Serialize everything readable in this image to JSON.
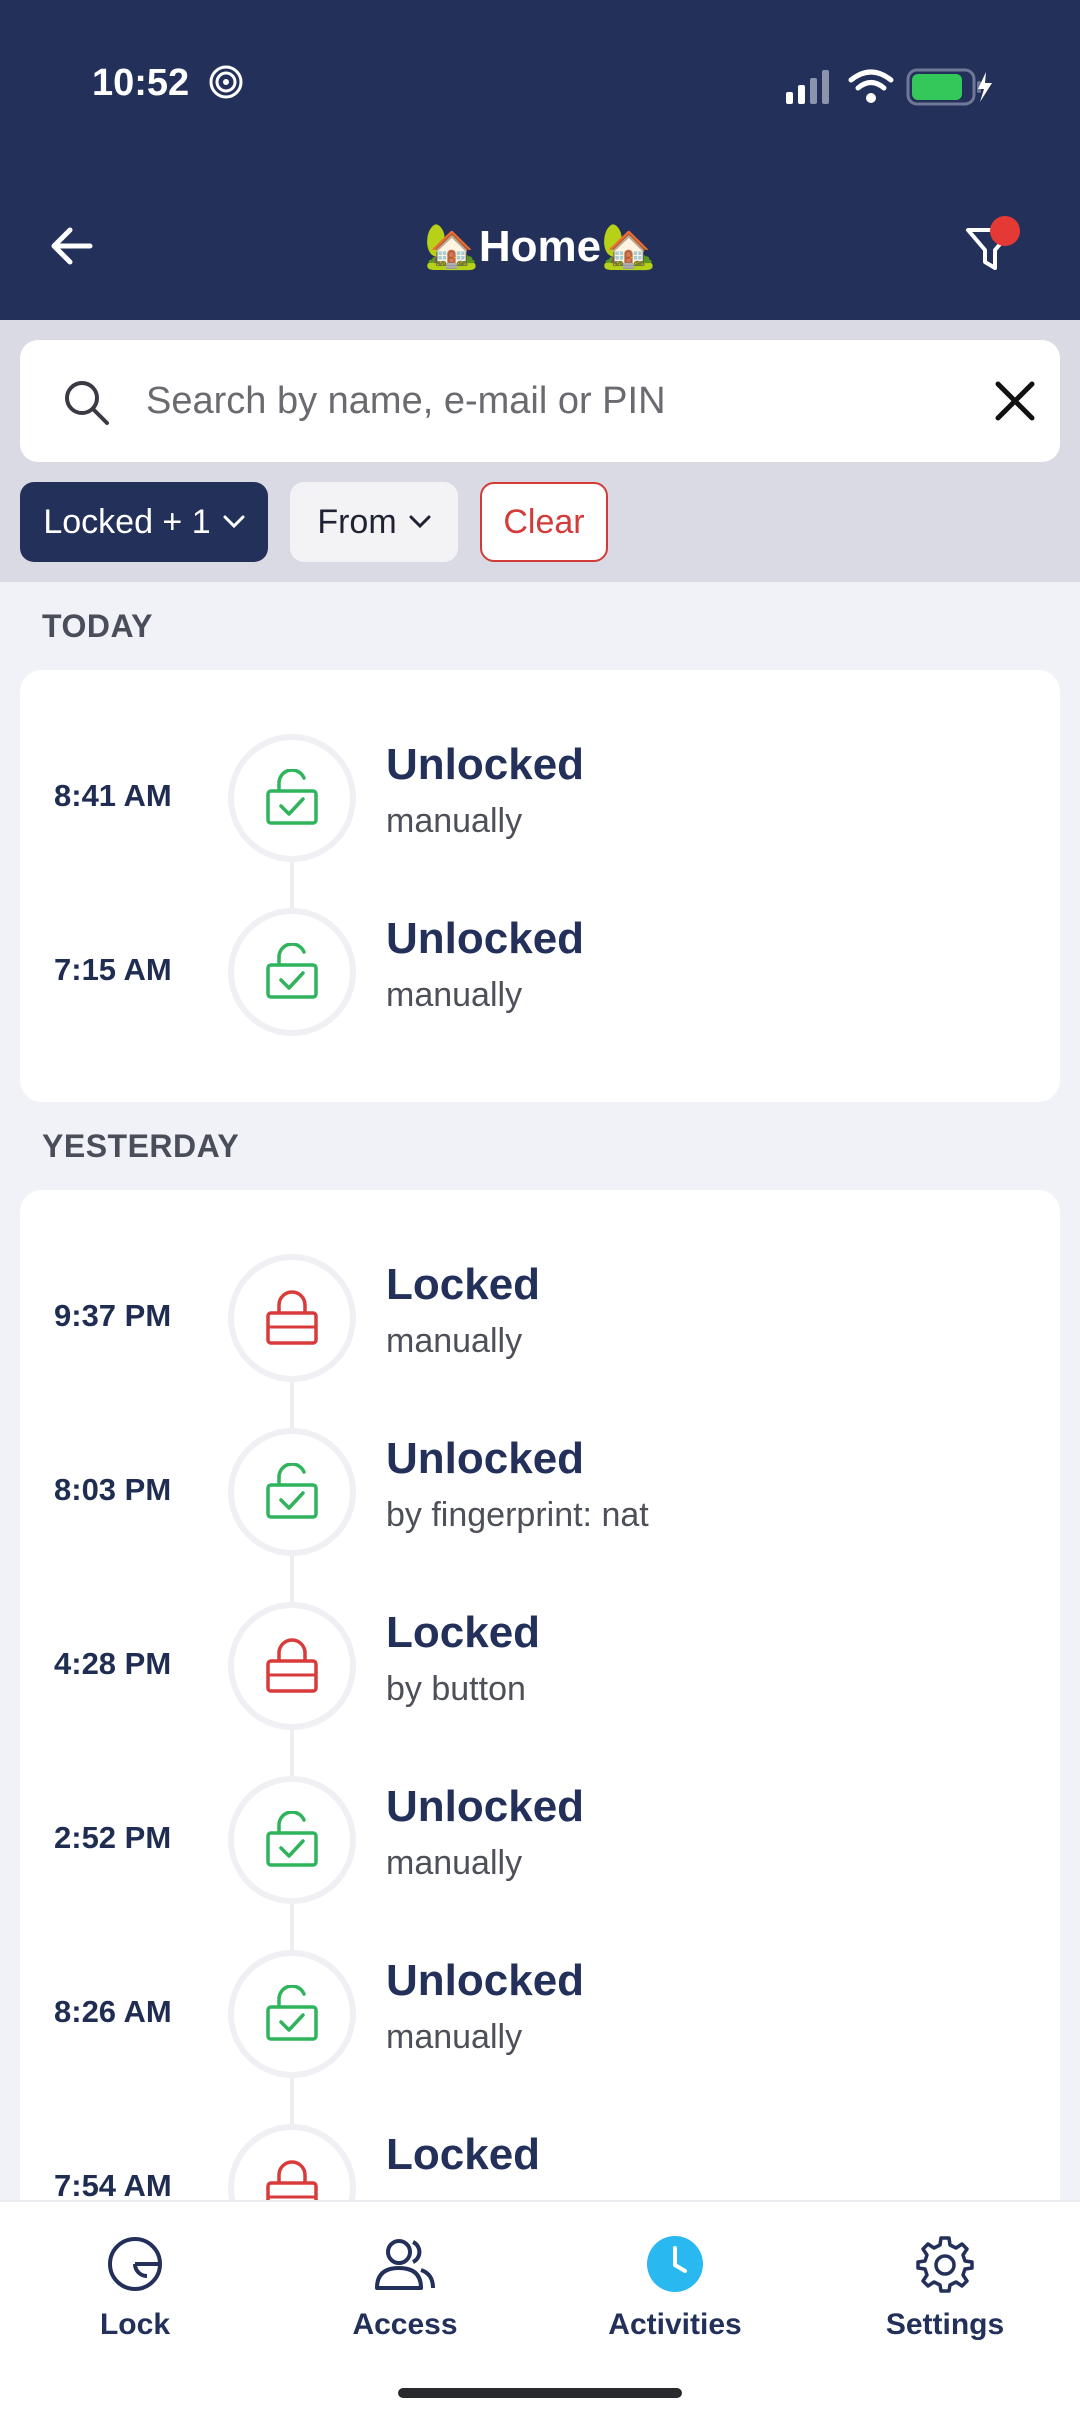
{
  "status_bar": {
    "time": "10:52"
  },
  "header": {
    "title": "🏡Home🏡"
  },
  "search": {
    "placeholder": "Search by name, e-mail or PIN"
  },
  "chips": {
    "locked": "Locked + 1",
    "from": "From",
    "clear": "Clear"
  },
  "sections": [
    {
      "label": "TODAY",
      "items": [
        {
          "time": "8:41 AM",
          "status": "Unlocked",
          "detail": "manually",
          "type": "unlock"
        },
        {
          "time": "7:15 AM",
          "status": "Unlocked",
          "detail": "manually",
          "type": "unlock"
        }
      ]
    },
    {
      "label": "YESTERDAY",
      "items": [
        {
          "time": "9:37 PM",
          "status": "Locked",
          "detail": "manually",
          "type": "lock"
        },
        {
          "time": "8:03 PM",
          "status": "Unlocked",
          "detail": "by fingerprint: nat",
          "type": "unlock"
        },
        {
          "time": "4:28 PM",
          "status": "Locked",
          "detail": "by button",
          "type": "lock"
        },
        {
          "time": "2:52 PM",
          "status": "Unlocked",
          "detail": "manually",
          "type": "unlock"
        },
        {
          "time": "8:26 AM",
          "status": "Unlocked",
          "detail": "manually",
          "type": "unlock"
        },
        {
          "time": "7:54 AM",
          "status": "Locked",
          "detail": "",
          "type": "lock"
        }
      ]
    }
  ],
  "nav": [
    {
      "label": "Lock",
      "icon": "lock-dial-icon"
    },
    {
      "label": "Access",
      "icon": "users-icon"
    },
    {
      "label": "Activities",
      "icon": "clock-icon",
      "active": true
    },
    {
      "label": "Settings",
      "icon": "gear-icon"
    }
  ],
  "colors": {
    "header": "#22305a",
    "unlock": "#2fb35b",
    "lock": "#d93a3a",
    "active_nav": "#29b8f0"
  }
}
